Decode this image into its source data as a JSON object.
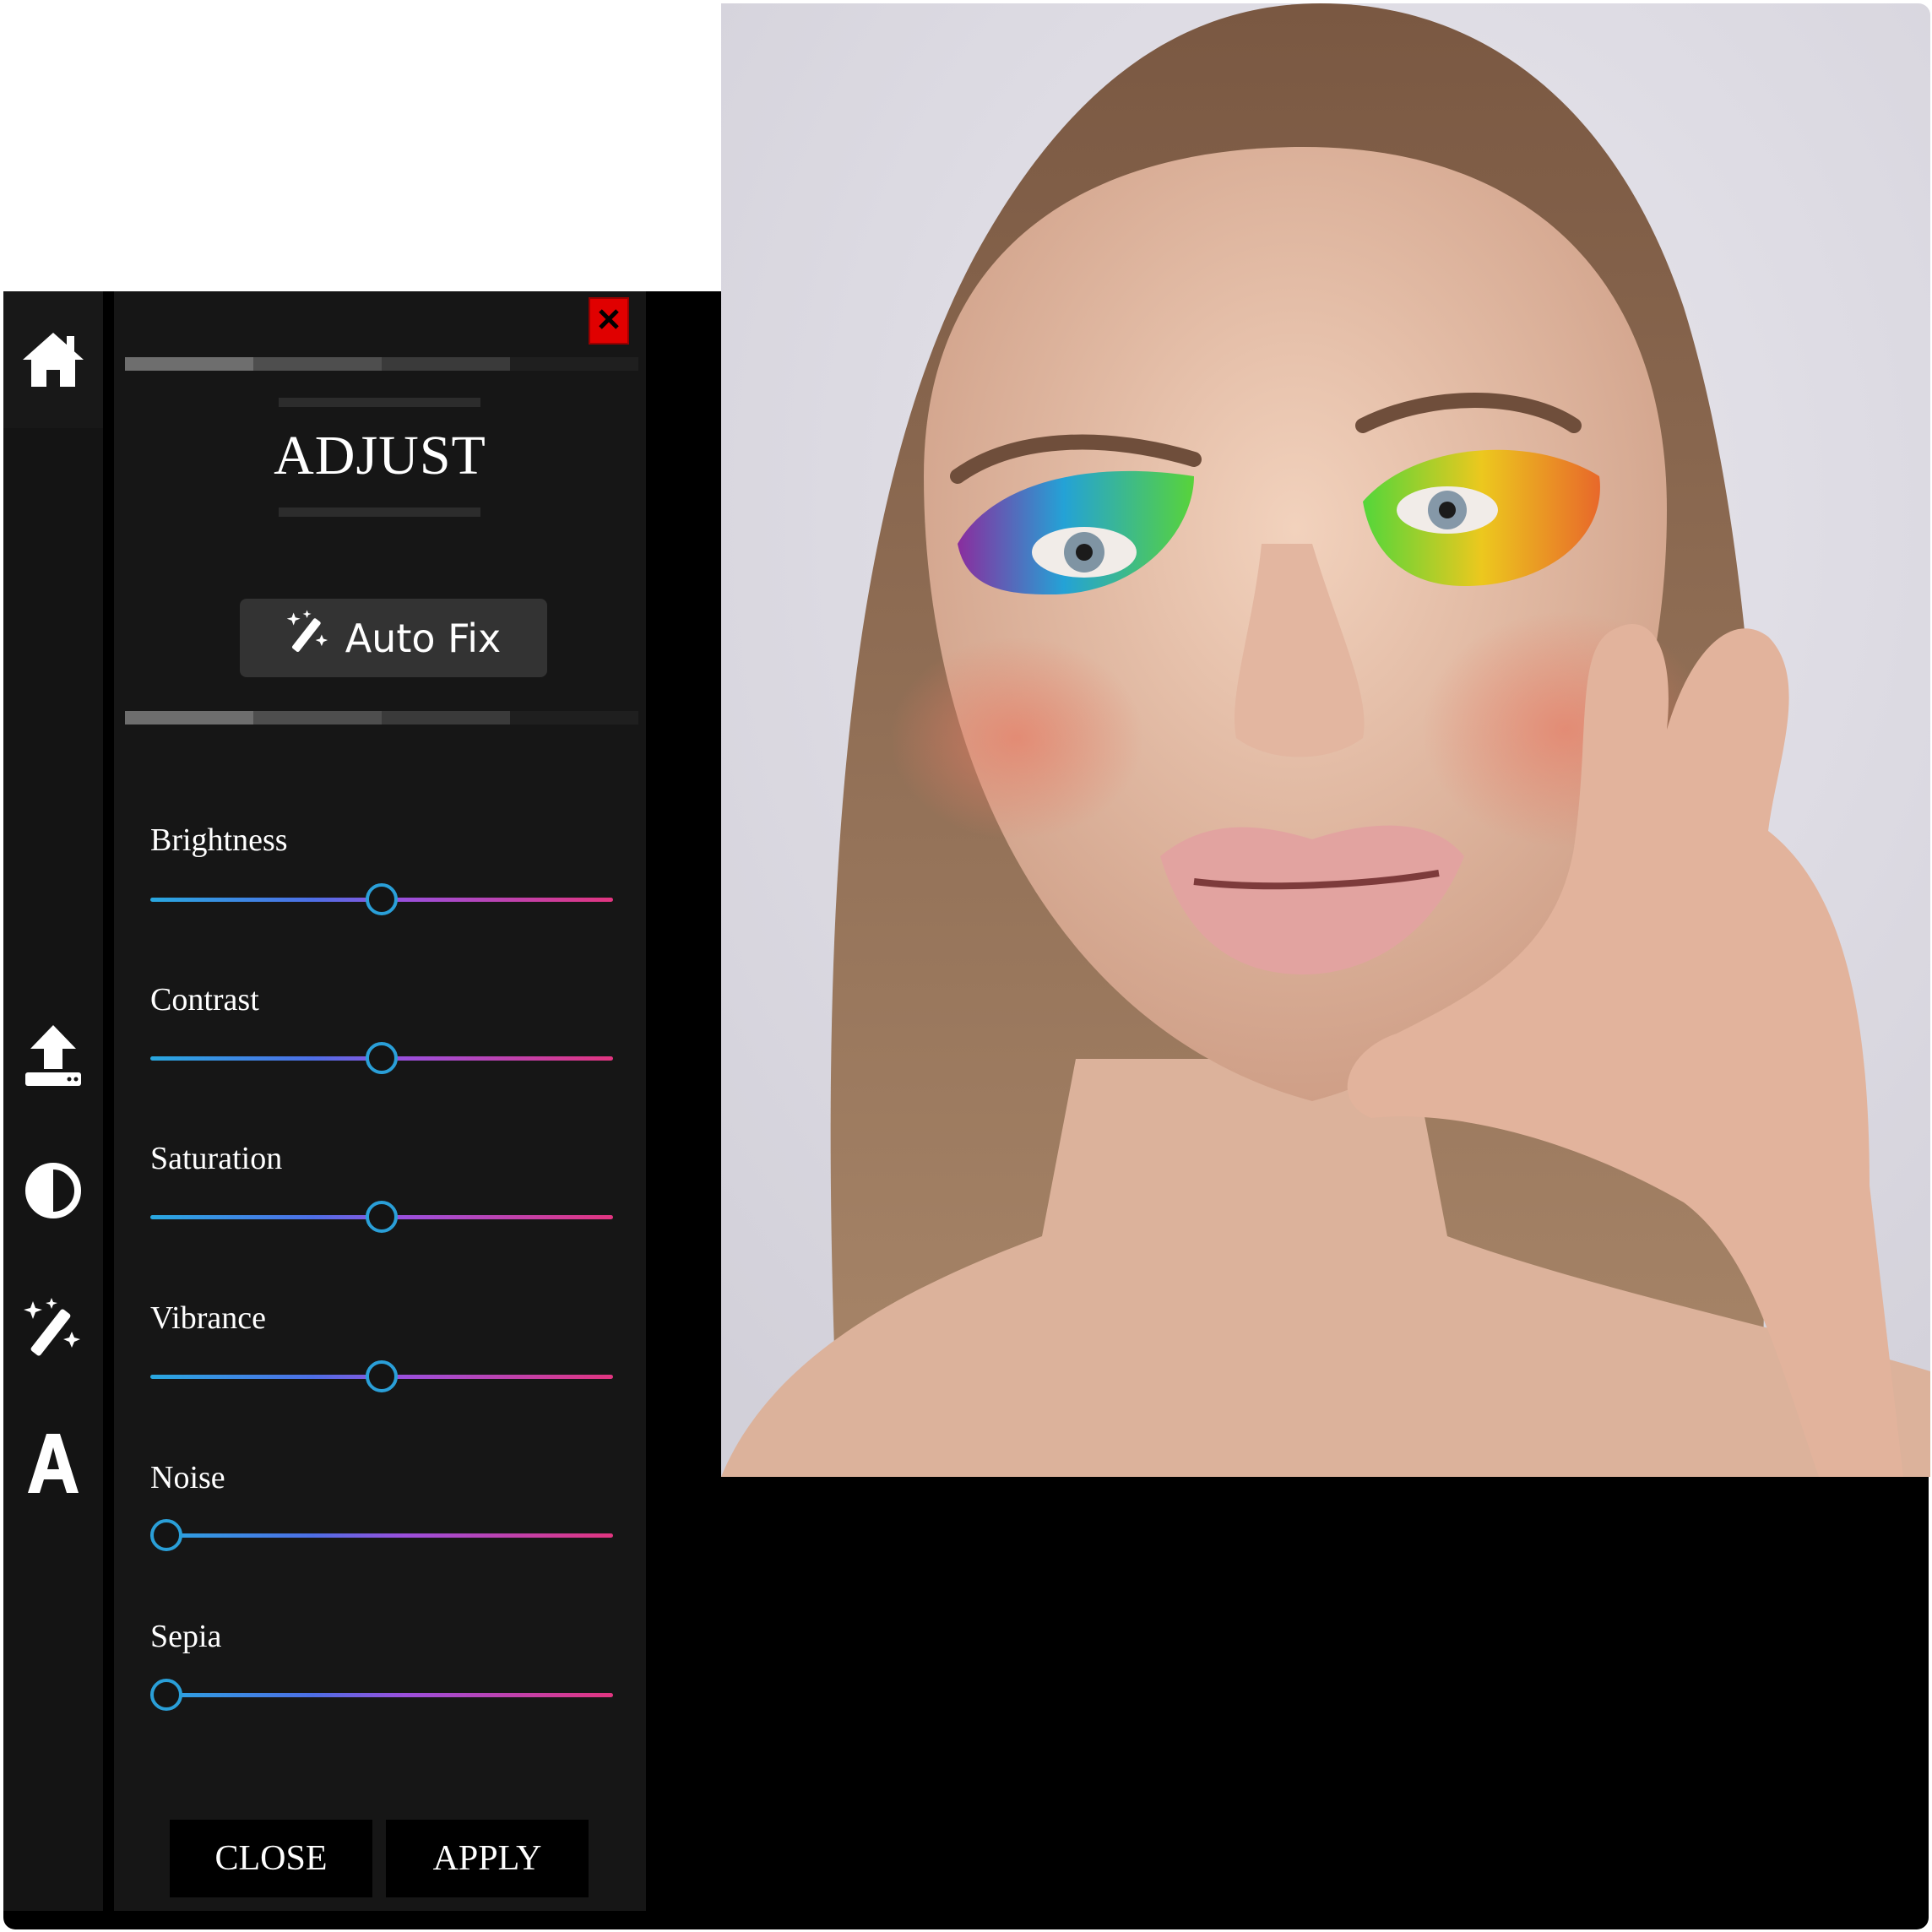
{
  "panel": {
    "title": "ADJUST",
    "auto_fix_label": "Auto Fix",
    "close_label": "CLOSE",
    "apply_label": "APPLY"
  },
  "sidebar": {
    "items": [
      {
        "icon": "home-icon"
      },
      {
        "icon": "upload-icon"
      },
      {
        "icon": "contrast-icon"
      },
      {
        "icon": "magic-wand-icon"
      },
      {
        "icon": "text-icon"
      }
    ]
  },
  "sliders": [
    {
      "label": "Brightness",
      "value": 0.5
    },
    {
      "label": "Contrast",
      "value": 0.5
    },
    {
      "label": "Saturation",
      "value": 0.5
    },
    {
      "label": "Vibrance",
      "value": 0.5
    },
    {
      "label": "Noise",
      "value": 0.0
    },
    {
      "label": "Sepia",
      "value": 0.0
    }
  ],
  "progress": {
    "segment_colors": [
      "#6e6e6e",
      "#4e4e4e",
      "#3a3a3a",
      "#1f1f1f"
    ]
  },
  "colors": {
    "close_x": "#e00000",
    "slider_start": "#29a8e0",
    "slider_end": "#e23580",
    "thumb": "#2a9fd8"
  }
}
